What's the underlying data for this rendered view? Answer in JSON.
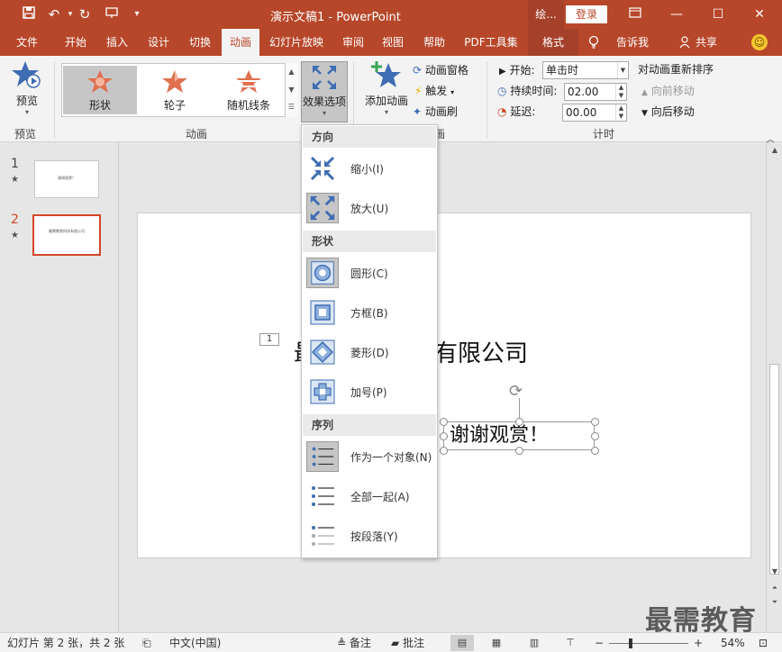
{
  "window": {
    "title": "演示文稿1 - PowerPoint",
    "tool_context": "绘...",
    "login_label": "登录"
  },
  "tabs": [
    {
      "label": "文件"
    },
    {
      "label": "开始"
    },
    {
      "label": "插入"
    },
    {
      "label": "设计"
    },
    {
      "label": "切换"
    },
    {
      "label": "动画"
    },
    {
      "label": "幻灯片放映"
    },
    {
      "label": "审阅"
    },
    {
      "label": "视图"
    },
    {
      "label": "帮助"
    },
    {
      "label": "PDF工具集"
    },
    {
      "label": "格式"
    }
  ],
  "tell_me": "告诉我",
  "share": "共享",
  "ribbon": {
    "preview": {
      "button": "预览",
      "group": "预览"
    },
    "animation": {
      "group": "动画",
      "gallery": [
        {
          "label": "形状",
          "selected": true
        },
        {
          "label": "轮子",
          "selected": false
        },
        {
          "label": "随机线条",
          "selected": false
        }
      ],
      "effect_options": "效果选项"
    },
    "advanced": {
      "add_animation": "添加动画",
      "pane": "动画窗格",
      "trigger": "触发",
      "painter": "动画刷",
      "group_tail": "画"
    },
    "timing": {
      "group": "计时",
      "start_label": "开始:",
      "start_value": "单击时",
      "duration_label": "持续时间:",
      "duration_value": "02.00",
      "delay_label": "延迟:",
      "delay_value": "00.00",
      "reorder_title": "对动画重新排序",
      "move_earlier": "向前移动",
      "move_later": "向后移动"
    }
  },
  "dropdown": {
    "sections": [
      {
        "header": "方向",
        "items": [
          {
            "label": "缩小(I)",
            "selected": false
          },
          {
            "label": "放大(U)",
            "selected": true
          }
        ]
      },
      {
        "header": "形状",
        "items": [
          {
            "label": "圆形(C)",
            "selected": true
          },
          {
            "label": "方框(B)",
            "selected": false
          },
          {
            "label": "菱形(D)",
            "selected": false
          },
          {
            "label": "加号(P)",
            "selected": false
          }
        ]
      },
      {
        "header": "序列",
        "items": [
          {
            "label": "作为一个对象(N)",
            "selected": true
          },
          {
            "label": "全部一起(A)",
            "selected": false
          },
          {
            "label": "按段落(Y)",
            "selected": false
          }
        ]
      }
    ]
  },
  "slides": [
    {
      "num": "1",
      "thumb_text": "谢谢观赏！"
    },
    {
      "num": "2",
      "thumb_text": "最需教育科技有限公司"
    }
  ],
  "slide": {
    "anim_tag": "1",
    "title": "最需教育科技有限公司",
    "textbox": "谢谢观赏！"
  },
  "status": {
    "slide_info": "幻灯片 第 2 张，共 2 张",
    "language": "中文(中国)",
    "notes": "备注",
    "comments": "批注",
    "zoom": "54%"
  },
  "watermark": "最需教育",
  "colors": {
    "accent": "#b7472a",
    "selection": "#d24726"
  }
}
